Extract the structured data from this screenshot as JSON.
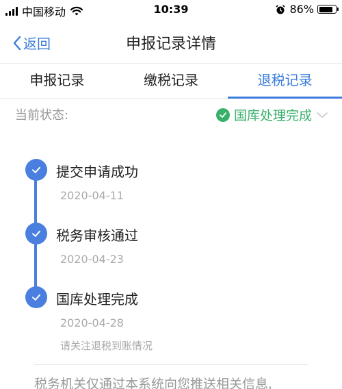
{
  "status_bar": {
    "carrier": "中国移动",
    "time": "10:39",
    "battery": "86%",
    "battery_level": 0.86
  },
  "nav": {
    "back_label": "返回",
    "title": "申报记录详情"
  },
  "tabs": [
    {
      "label": "申报记录",
      "active": false
    },
    {
      "label": "缴税记录",
      "active": false
    },
    {
      "label": "退税记录",
      "active": true
    }
  ],
  "status": {
    "label": "当前状态:",
    "value": "国库处理完成"
  },
  "timeline": [
    {
      "title": "提交申请成功",
      "date": "2020-04-11",
      "note": ""
    },
    {
      "title": "税务审核通过",
      "date": "2020-04-23",
      "note": ""
    },
    {
      "title": "国库处理完成",
      "date": "2020-04-28",
      "note": "请关注退税到账情况"
    }
  ],
  "footer": {
    "text": "税务机关仅通过本系统向您推送相关信息,"
  },
  "colors": {
    "accent": "#3b7ddd",
    "success": "#39b06a",
    "timeline": "#4a7fe0"
  }
}
